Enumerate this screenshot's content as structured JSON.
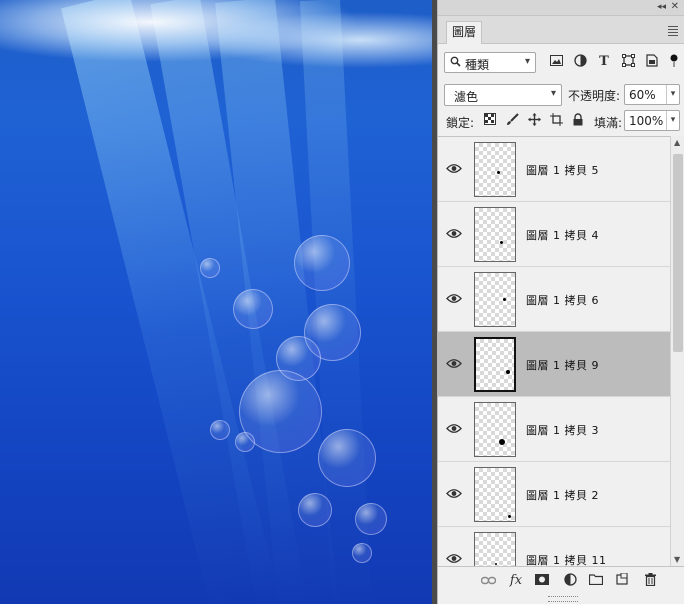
{
  "panel": {
    "title": "圖層",
    "collapse_glyph": "◂◂",
    "close_glyph": "✕"
  },
  "filter": {
    "kind_label": "種類",
    "icons": [
      "pixel-filter-icon",
      "adjustment-filter-icon",
      "type-filter-icon",
      "shape-filter-icon",
      "smart-object-filter-icon",
      "filter-toggle-icon"
    ]
  },
  "blend": {
    "mode": "濾色",
    "opacity_label": "不透明度:",
    "opacity_value": "60%"
  },
  "lock": {
    "label": "鎖定:",
    "icons": [
      "lock-transparent-icon",
      "lock-image-icon",
      "lock-position-icon",
      "lock-artboard-icon",
      "lock-all-icon"
    ],
    "fill_label": "填滿:",
    "fill_value": "100%"
  },
  "layers": [
    {
      "name": "圖層 1 拷貝 5",
      "visible": true,
      "selected": false
    },
    {
      "name": "圖層 1 拷貝 4",
      "visible": true,
      "selected": false
    },
    {
      "name": "圖層 1 拷貝 6",
      "visible": true,
      "selected": false
    },
    {
      "name": "圖層 1 拷貝 9",
      "visible": true,
      "selected": true
    },
    {
      "name": "圖層 1 拷貝 3",
      "visible": true,
      "selected": false
    },
    {
      "name": "圖層 1 拷貝 2",
      "visible": true,
      "selected": false
    },
    {
      "name": "圖層 1 拷貝 11",
      "visible": true,
      "selected": false
    }
  ],
  "bottom_icons": [
    "link-layers-icon",
    "fx-icon",
    "add-mask-icon",
    "adjustment-layer-icon",
    "group-folder-icon",
    "new-layer-icon",
    "delete-layer-icon"
  ],
  "bottom_fx_label": "fx",
  "colors": {
    "water_top": "#1e5ec8",
    "water_bottom": "#1239b4",
    "panel_bg": "#f0f0f0",
    "selected_row": "#bcbcbc"
  }
}
